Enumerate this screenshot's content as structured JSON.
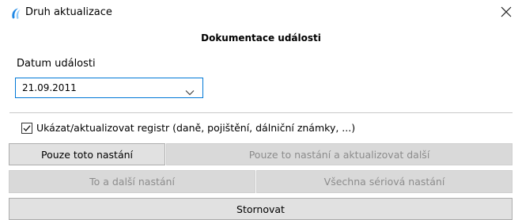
{
  "window": {
    "title": "Druh aktualizace"
  },
  "main": {
    "heading": "Dokumentace události",
    "date_label": "Datum události",
    "date_value": "21.09.2011",
    "checkbox": {
      "label": "Ukázat/aktualizovat registr (daně, pojištění, dálniční známky, ...)",
      "checked": true
    }
  },
  "buttons": {
    "only_this": "Pouze toto nastání",
    "only_this_update_next": "Pouze to nastání a aktualizovat další",
    "this_and_next": "To a další nastání",
    "all_series": "Všechna sériová nastání",
    "cancel": "Stornovat"
  },
  "colors": {
    "focus_border": "#0078d7",
    "app_icon": "#1e88e5",
    "disabled_text": "#8c8c8c"
  },
  "icons": {
    "app": "app-logo-icon",
    "close": "close-icon",
    "dropdown": "chevron-down-icon",
    "check": "checkmark-icon"
  }
}
